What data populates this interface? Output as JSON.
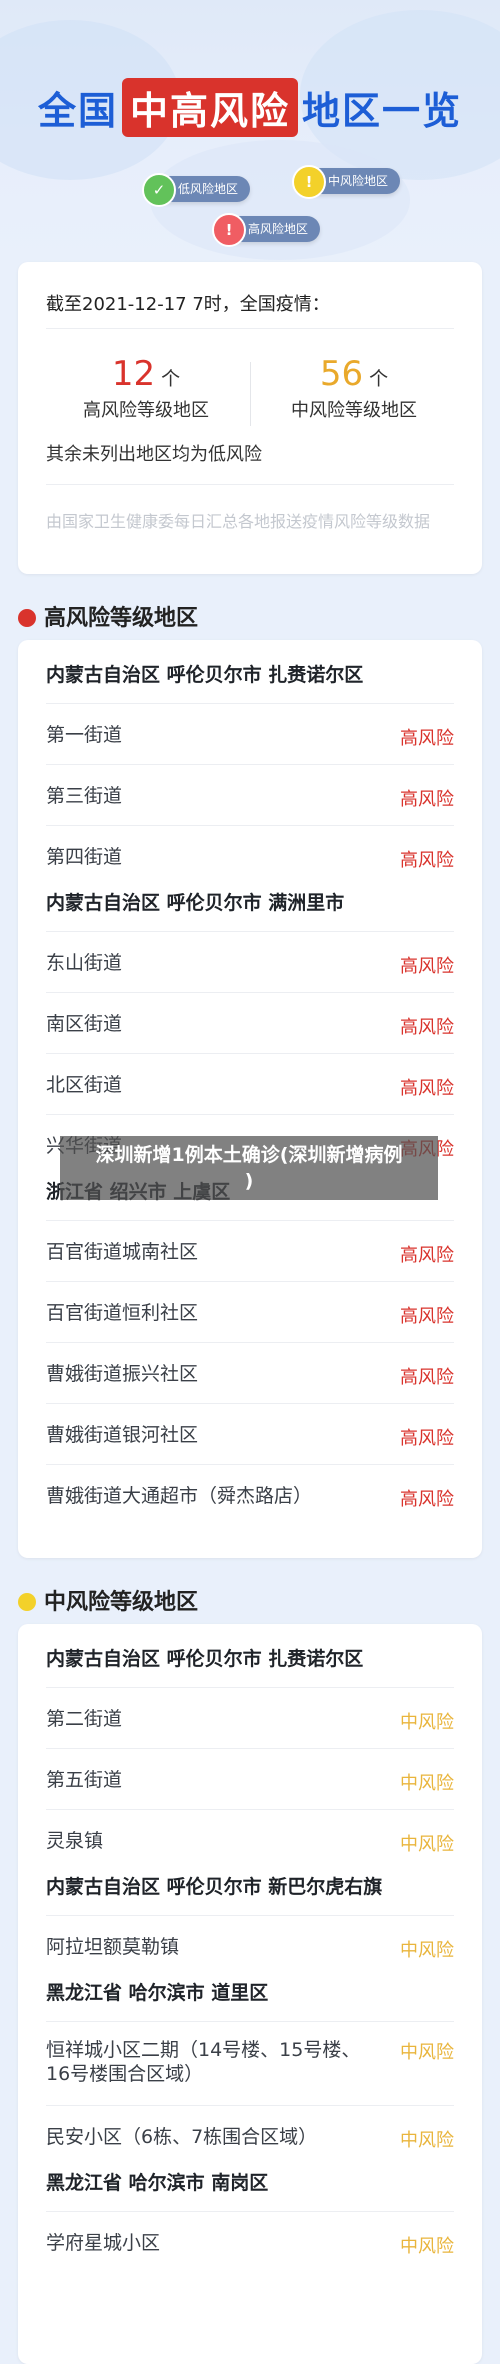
{
  "hero": {
    "title_prefix": "全国",
    "title_highlight": "中高风险",
    "title_suffix": "地区一览",
    "legend": {
      "low": "低风险地区",
      "mid": "中风险地区",
      "high": "高风险地区"
    },
    "colors": {
      "low": "#62c25a",
      "mid": "#f3d12a",
      "high": "#f05d63",
      "title": "#1d5ed6",
      "highlight": "#d9332c"
    }
  },
  "summary": {
    "date_text": "截至2021-12-17 7时，全国疫情：",
    "high_count": "12",
    "high_unit": "个",
    "high_label": "高风险等级地区",
    "mid_count": "56",
    "mid_unit": "个",
    "mid_label": "中风险等级地区",
    "note": "其余未列出地区均为低风险",
    "source": "由国家卫生健康委每日汇总各地报送疫情风险等级数据"
  },
  "high_section": {
    "title": "高风险等级地区",
    "groups": [
      {
        "region": "内蒙古自治区 呼伦贝尔市 扎赉诺尔区",
        "rows": [
          {
            "name": "第一街道",
            "level": "高风险"
          },
          {
            "name": "第三街道",
            "level": "高风险"
          },
          {
            "name": "第四街道",
            "level": "高风险"
          }
        ]
      },
      {
        "region": "内蒙古自治区 呼伦贝尔市 满洲里市",
        "rows": [
          {
            "name": "东山街道",
            "level": "高风险"
          },
          {
            "name": "南区街道",
            "level": "高风险"
          },
          {
            "name": "北区街道",
            "level": "高风险"
          },
          {
            "name": "兴华街道",
            "level": "高风险"
          }
        ]
      },
      {
        "region": "浙江省 绍兴市 上虞区",
        "rows": [
          {
            "name": "百官街道城南社区",
            "level": "高风险"
          },
          {
            "name": "百官街道恒利社区",
            "level": "高风险"
          },
          {
            "name": "曹娥街道振兴社区",
            "level": "高风险"
          },
          {
            "name": "曹娥街道银河社区",
            "level": "高风险"
          },
          {
            "name": "曹娥街道大通超市（舜杰路店）",
            "level": "高风险"
          }
        ]
      }
    ]
  },
  "mid_section": {
    "title": "中风险等级地区",
    "groups": [
      {
        "region": "内蒙古自治区 呼伦贝尔市 扎赉诺尔区",
        "rows": [
          {
            "name": "第二街道",
            "level": "中风险"
          },
          {
            "name": "第五街道",
            "level": "中风险"
          },
          {
            "name": "灵泉镇",
            "level": "中风险"
          }
        ]
      },
      {
        "region": "内蒙古自治区 呼伦贝尔市 新巴尔虎右旗",
        "rows": [
          {
            "name": "阿拉坦额莫勒镇",
            "level": "中风险"
          }
        ]
      },
      {
        "region": "黑龙江省 哈尔滨市 道里区",
        "rows": [
          {
            "name": "恒祥城小区二期（14号楼、15号楼、16号楼围合区域）",
            "level": "中风险"
          },
          {
            "name": "民安小区（6栋、7栋围合区域）",
            "level": "中风险"
          }
        ]
      },
      {
        "region": "黑龙江省 哈尔滨市 南岗区",
        "rows": [
          {
            "name": "学府星城小区",
            "level": "中风险"
          }
        ]
      }
    ]
  },
  "overlay": {
    "line1": "深圳新增1例本土确诊(深圳新增病例",
    "line2": ")"
  }
}
